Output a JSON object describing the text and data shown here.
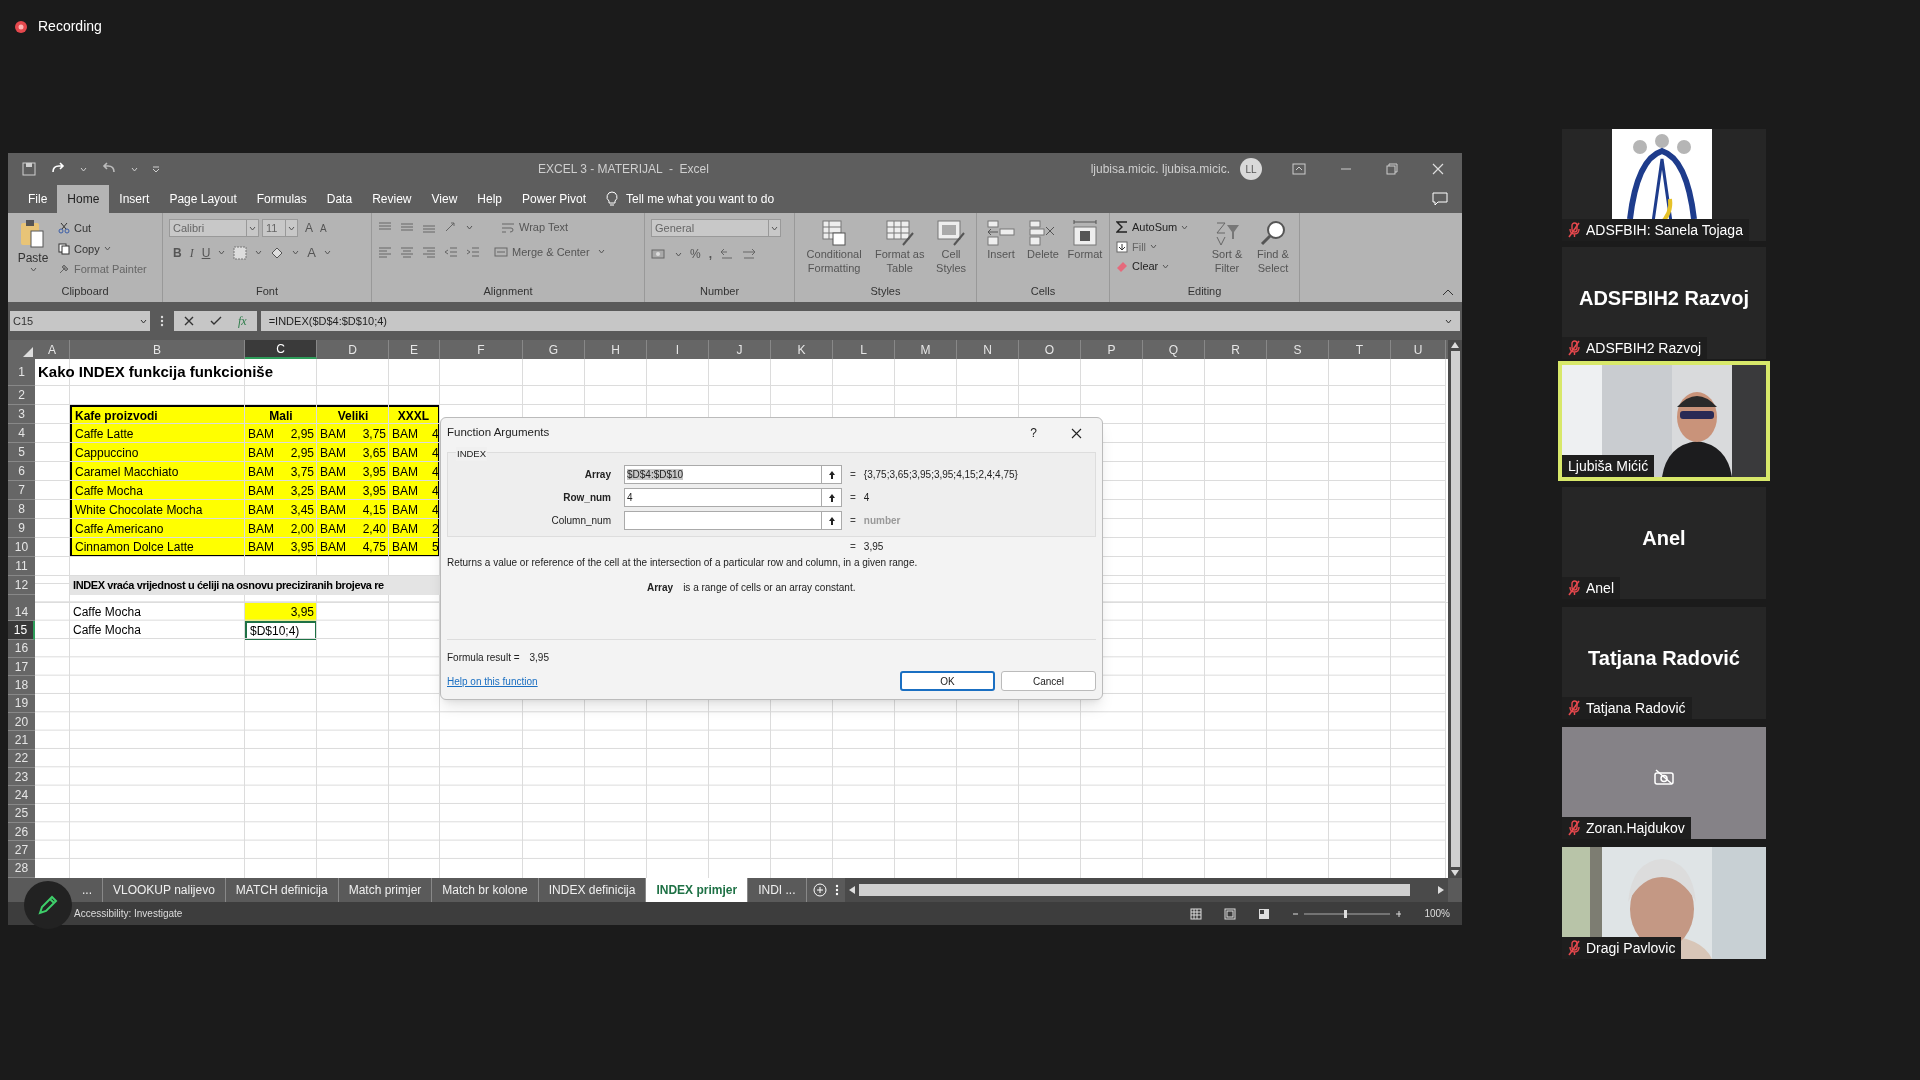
{
  "recording": {
    "label": "Recording"
  },
  "excel": {
    "title": "EXCEL 3 - MATERIJAL  -  Excel",
    "account": "ljubisa.micic. ljubisa.micic.",
    "avatar": "LL",
    "menu_tabs": [
      {
        "label": "File",
        "selected": false
      },
      {
        "label": "Home",
        "selected": true
      },
      {
        "label": "Insert",
        "selected": false
      },
      {
        "label": "Page Layout",
        "selected": false
      },
      {
        "label": "Formulas",
        "selected": false
      },
      {
        "label": "Data",
        "selected": false
      },
      {
        "label": "Review",
        "selected": false
      },
      {
        "label": "View",
        "selected": false
      },
      {
        "label": "Help",
        "selected": false
      },
      {
        "label": "Power Pivot",
        "selected": false
      }
    ],
    "tell_me": "Tell me what you want to do",
    "ribbon": {
      "clipboard": {
        "label": "Clipboard",
        "paste": "Paste",
        "cut": "Cut",
        "copy": "Copy",
        "format_painter": "Format Painter"
      },
      "font": {
        "label": "Font",
        "font_name": "Calibri",
        "font_size": "11",
        "grow": "A",
        "shrink": "A",
        "bold": "B",
        "italic": "I",
        "underline": "U",
        "font_color": "A"
      },
      "alignment": {
        "label": "Alignment",
        "wrap_text": "Wrap Text",
        "merge": "Merge & Center"
      },
      "number": {
        "label": "Number",
        "format": "General",
        "percent": "%",
        "comma": ","
      },
      "styles": {
        "label": "Styles",
        "buttons": [
          "Conditional Formatting",
          "Format as Table",
          "Cell Styles"
        ]
      },
      "cells": {
        "label": "Cells",
        "buttons": [
          "Insert",
          "Delete",
          "Format"
        ]
      },
      "editing": {
        "label": "Editing",
        "autosum": "AutoSum",
        "fill": "Fill",
        "clear": "Clear",
        "buttons": [
          "Sort & Filter",
          "Find & Select"
        ]
      }
    },
    "formula_bar": {
      "name_box": "C15",
      "fx": "fx",
      "formula": "=INDEX($D$4:$D$10;4)"
    },
    "columns": [
      {
        "label": "A",
        "selected": false
      },
      {
        "label": "B",
        "selected": false
      },
      {
        "label": "C",
        "selected": true
      },
      {
        "label": "D",
        "selected": false
      },
      {
        "label": "E",
        "selected": false
      },
      {
        "label": "F",
        "selected": false
      },
      {
        "label": "G",
        "selected": false
      },
      {
        "label": "H",
        "selected": false
      },
      {
        "label": "I",
        "selected": false
      },
      {
        "label": "J",
        "selected": false
      },
      {
        "label": "K",
        "selected": false
      },
      {
        "label": "L",
        "selected": false
      },
      {
        "label": "M",
        "selected": false
      },
      {
        "label": "N",
        "selected": false
      },
      {
        "label": "O",
        "selected": false
      },
      {
        "label": "P",
        "selected": false
      },
      {
        "label": "Q",
        "selected": false
      },
      {
        "label": "R",
        "selected": false
      },
      {
        "label": "S",
        "selected": false
      },
      {
        "label": "T",
        "selected": false
      },
      {
        "label": "U",
        "selected": false
      }
    ],
    "rows": [
      {
        "n": "1",
        "selected": false,
        "kind": "title",
        "cells": [
          {
            "text": "Kako INDEX funkcija funkcioniše"
          }
        ]
      },
      {
        "n": "2",
        "selected": false
      },
      {
        "n": "3",
        "selected": false,
        "kind": "table_head",
        "cells": [
          null,
          {
            "text": "Kafe proizvodi"
          },
          {
            "text": "Mali"
          },
          {
            "text": "Veliki"
          },
          {
            "text": "XXXL"
          }
        ]
      },
      {
        "n": "4",
        "selected": false,
        "kind": "table_row",
        "cells": [
          null,
          {
            "text": "Caffe Latte"
          },
          {
            "currency": "BAM",
            "text": "2,95"
          },
          {
            "currency": "BAM",
            "text": "3,75"
          },
          {
            "currency": "BAM",
            "text": "4"
          }
        ]
      },
      {
        "n": "5",
        "selected": false,
        "kind": "table_row",
        "cells": [
          null,
          {
            "text": "Cappuccino"
          },
          {
            "currency": "BAM",
            "text": "2,95"
          },
          {
            "currency": "BAM",
            "text": "3,65"
          },
          {
            "currency": "BAM",
            "text": "4"
          }
        ]
      },
      {
        "n": "6",
        "selected": false,
        "kind": "table_row",
        "cells": [
          null,
          {
            "text": "Caramel Macchiato"
          },
          {
            "currency": "BAM",
            "text": "3,75"
          },
          {
            "currency": "BAM",
            "text": "3,95"
          },
          {
            "currency": "BAM",
            "text": "4"
          }
        ]
      },
      {
        "n": "7",
        "selected": false,
        "kind": "table_row",
        "cells": [
          null,
          {
            "text": "Caffe Mocha"
          },
          {
            "currency": "BAM",
            "text": "3,25"
          },
          {
            "currency": "BAM",
            "text": "3,95"
          },
          {
            "currency": "BAM",
            "text": "4"
          }
        ]
      },
      {
        "n": "8",
        "selected": false,
        "kind": "table_row",
        "cells": [
          null,
          {
            "text": "White Chocolate Mocha"
          },
          {
            "currency": "BAM",
            "text": "3,45"
          },
          {
            "currency": "BAM",
            "text": "4,15"
          },
          {
            "currency": "BAM",
            "text": "4"
          }
        ]
      },
      {
        "n": "9",
        "selected": false,
        "kind": "table_row",
        "cells": [
          null,
          {
            "text": "Caffe Americano"
          },
          {
            "currency": "BAM",
            "text": "2,00"
          },
          {
            "currency": "BAM",
            "text": "2,40"
          },
          {
            "currency": "BAM",
            "text": "2"
          }
        ]
      },
      {
        "n": "10",
        "selected": false,
        "kind": "table_end",
        "cells": [
          null,
          {
            "text": "Cinnamon Dolce Latte"
          },
          {
            "currency": "BAM",
            "text": "3,95"
          },
          {
            "currency": "BAM",
            "text": "4,75"
          },
          {
            "currency": "BAM",
            "text": "5"
          }
        ]
      },
      {
        "n": "11",
        "selected": false
      },
      {
        "n": "12",
        "selected": false,
        "kind": "note",
        "cells": [
          null,
          {
            "text": "INDEX vraća vrijednost u ćeliji na osnovu preciziranih brojeva re"
          }
        ]
      },
      {
        "n": "14",
        "selected": false,
        "cells": [
          null,
          {
            "text": "Caffe Mocha"
          },
          {
            "text": "3,95",
            "kind": "result"
          }
        ]
      },
      {
        "n": "15",
        "selected": true,
        "cells": [
          null,
          {
            "text": "Caffe Mocha"
          },
          {
            "text": "$D$10;4)",
            "kind": "editing"
          }
        ]
      },
      {
        "n": "16",
        "selected": false
      },
      {
        "n": "17",
        "selected": false
      },
      {
        "n": "18",
        "selected": false
      },
      {
        "n": "19",
        "selected": false
      },
      {
        "n": "20",
        "selected": false
      },
      {
        "n": "21",
        "selected": false
      },
      {
        "n": "22",
        "selected": false
      },
      {
        "n": "23",
        "selected": false
      },
      {
        "n": "24",
        "selected": false
      },
      {
        "n": "25",
        "selected": false
      },
      {
        "n": "26",
        "selected": false
      },
      {
        "n": "27",
        "selected": false
      },
      {
        "n": "28",
        "selected": false
      }
    ],
    "dialog": {
      "title": "Function Arguments",
      "help_mark": "?",
      "function": "INDEX",
      "args": [
        {
          "label": "Array",
          "required": true,
          "value": "$D$4:$D$10",
          "value_selected": true,
          "equals": "=",
          "result": "{3,75;3,65;3,95;3,95;4,15;2,4;4,75}",
          "result_hint": false
        },
        {
          "label": "Row_num",
          "required": true,
          "value": "4",
          "value_selected": false,
          "equals": "=",
          "result": "4",
          "result_hint": false
        },
        {
          "label": "Column_num",
          "required": false,
          "equals": "=",
          "result": "number",
          "result_hint": true
        }
      ],
      "total_equals": "=",
      "total": "3,95",
      "description": "Returns a value or reference of the cell at the intersection of a particular row and column, in a given range.",
      "arg_help": {
        "name": "Array",
        "text": "is a range of cells or an array constant."
      },
      "formula_result_label": "Formula result =",
      "formula_result": "3,95",
      "help_link": "Help on this function",
      "buttons": [
        {
          "label": "OK",
          "default": true
        },
        {
          "label": "Cancel",
          "default": false
        }
      ]
    },
    "sheet_tabs": [
      {
        "label": "...",
        "selected": false
      },
      {
        "label": "VLOOKUP nalijevo",
        "selected": false
      },
      {
        "label": "MATCH definicija",
        "selected": false
      },
      {
        "label": "Match primjer",
        "selected": false
      },
      {
        "label": "Match br kolone",
        "selected": false
      },
      {
        "label": "INDEX definicija",
        "selected": false
      },
      {
        "label": "INDEX primjer",
        "selected": true
      },
      {
        "label": "INDI ...",
        "selected": false
      }
    ],
    "status": {
      "accessibility": "Accessibility: Investigate",
      "zoom": "100%"
    }
  },
  "participants": [
    {
      "name": "ADSFBIH: Sanela Tojaga",
      "kind": "picture",
      "muted": true,
      "speaking": false
    },
    {
      "name": "ADSFBIH2 Razvoj",
      "kind": "name",
      "display": "ADSFBIH2 Razvoj",
      "muted": true,
      "speaking": false
    },
    {
      "name": "Ljubiša Mićić",
      "kind": "video",
      "muted": false,
      "speaking": true
    },
    {
      "name": "Anel",
      "kind": "name",
      "display": "Anel",
      "muted": true,
      "speaking": false
    },
    {
      "name": "Tatjana Radović",
      "kind": "name",
      "display": "Tatjana Radović",
      "muted": true,
      "speaking": false
    },
    {
      "name": "Zoran.Hajdukov",
      "kind": "camera_off",
      "muted": true,
      "speaking": false
    },
    {
      "name": "Dragi Pavlovic",
      "kind": "video",
      "muted": true,
      "speaking": false
    }
  ]
}
